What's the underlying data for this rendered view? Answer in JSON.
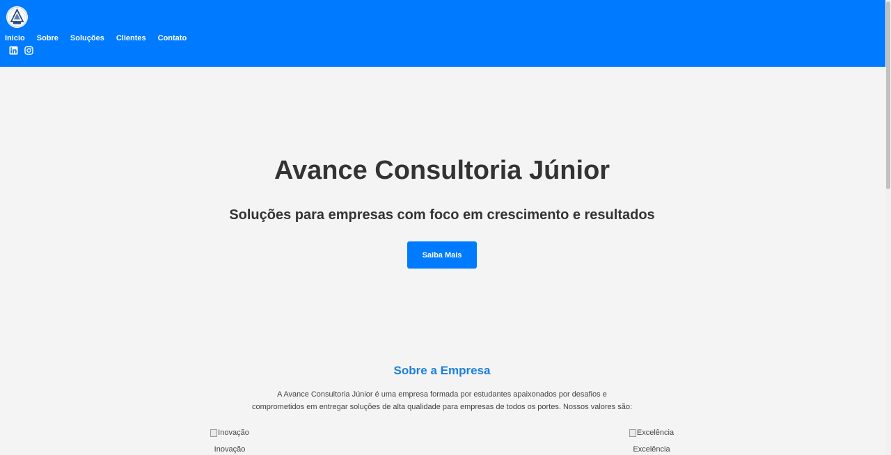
{
  "header": {
    "background_color": "#007bff",
    "logo_icon": "logo-icon",
    "nav": [
      {
        "label": "Inicio"
      },
      {
        "label": "Sobre"
      },
      {
        "label": "Soluções"
      },
      {
        "label": "Clientes"
      },
      {
        "label": "Contato"
      }
    ],
    "social": [
      {
        "icon": "linkedin-icon"
      },
      {
        "icon": "instagram-icon"
      }
    ]
  },
  "hero": {
    "title": "Avance Consultoria Júnior",
    "subtitle": "Soluções para empresas com foco em crescimento e resultados",
    "cta_label": "Saiba Mais",
    "accent_color": "#007bff"
  },
  "about": {
    "title": "Sobre a Empresa",
    "text_line1": "A Avance Consultoria Júnior é uma empresa formada por estudantes apaixonados por desafios e",
    "text_line2": "comprometidos em entregar soluções de alta qualidade para empresas de todos os portes. Nossos valores são:",
    "values": [
      {
        "alt": "Inovação",
        "label": "Inovação"
      },
      {
        "alt": "Excelência",
        "label": "Excelência"
      }
    ]
  }
}
